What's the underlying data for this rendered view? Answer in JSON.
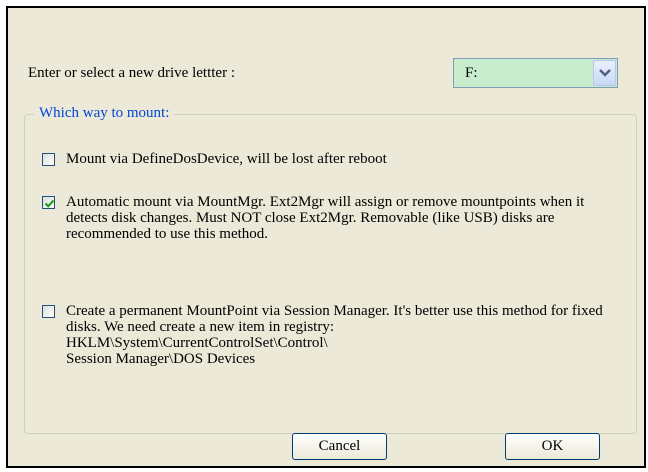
{
  "drive": {
    "label": "Enter or select a new drive lettter :",
    "selected": "F:"
  },
  "mount_group": {
    "title": "Which way to mount:",
    "options": [
      {
        "label": "Mount via DefineDosDevice, will be lost after reboot",
        "checked": false
      },
      {
        "label": "Automatic mount via MountMgr. Ext2Mgr will assign or remove mountpoints when it detects disk changes. Must NOT close Ext2Mgr. Removable (like USB) disks are recommended to use this method.",
        "checked": true
      },
      {
        "label_lines": [
          "Create a permanent MountPoint via Session Manager. It's better use this method for fixed disks. We need create a new item in registry:",
          "HKLM\\System\\CurrentControlSet\\Control\\",
          "Session Manager\\DOS Devices"
        ],
        "checked": false
      }
    ]
  },
  "buttons": {
    "cancel": "Cancel",
    "ok": "OK"
  },
  "colors": {
    "dialog_bg": "#ece9d8",
    "combo_bg": "#c7edcc",
    "group_title": "#0046d5",
    "checkmark": "#21a121"
  },
  "icons": {
    "dropdown": "chevron-down-icon",
    "check": "checkmark-icon"
  }
}
